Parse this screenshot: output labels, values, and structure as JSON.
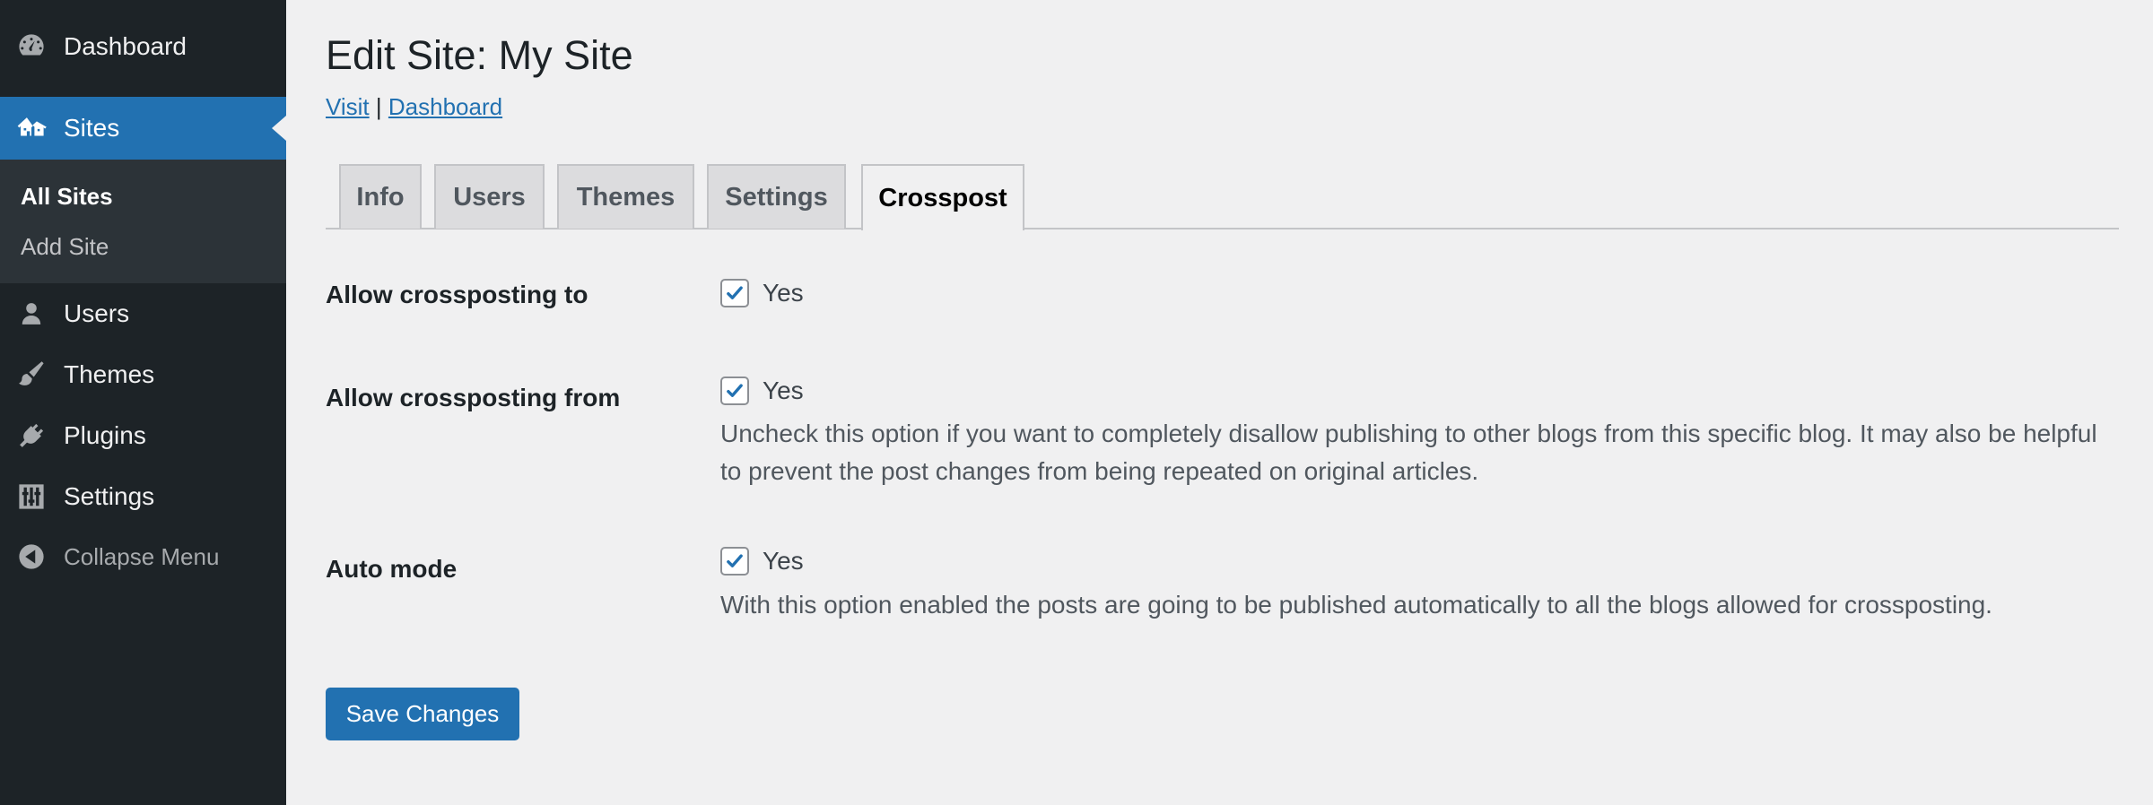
{
  "sidebar": {
    "dashboard": "Dashboard",
    "sites": "Sites",
    "submenu": {
      "all_sites": "All Sites",
      "add_site": "Add Site"
    },
    "users": "Users",
    "themes": "Themes",
    "plugins": "Plugins",
    "settings": "Settings",
    "collapse": "Collapse Menu"
  },
  "header": {
    "title": "Edit Site: My Site",
    "visit_link": "Visit",
    "separator": "|",
    "dashboard_link": "Dashboard"
  },
  "tabs": [
    {
      "label": "Info",
      "active": false
    },
    {
      "label": "Users",
      "active": false
    },
    {
      "label": "Themes",
      "active": false
    },
    {
      "label": "Settings",
      "active": false
    },
    {
      "label": "Crosspost",
      "active": true
    }
  ],
  "form": {
    "allow_to": {
      "label": "Allow crossposting to",
      "checkbox_label": "Yes",
      "checked": true
    },
    "allow_from": {
      "label": "Allow crossposting from",
      "checkbox_label": "Yes",
      "checked": true,
      "description": "Uncheck this option if you want to completely disallow publishing to other blogs from this specific blog. It may also be helpful to prevent the post changes from being repeated on original articles."
    },
    "auto_mode": {
      "label": "Auto mode",
      "checkbox_label": "Yes",
      "checked": true,
      "description": "With this option enabled the posts are going to be published automatically to all the blogs allowed for crossposting."
    },
    "save_label": "Save Changes"
  },
  "colors": {
    "accent": "#2271b1",
    "sidebar_bg": "#1d2327",
    "submenu_bg": "#2c3338",
    "page_bg": "#f0f0f1"
  }
}
